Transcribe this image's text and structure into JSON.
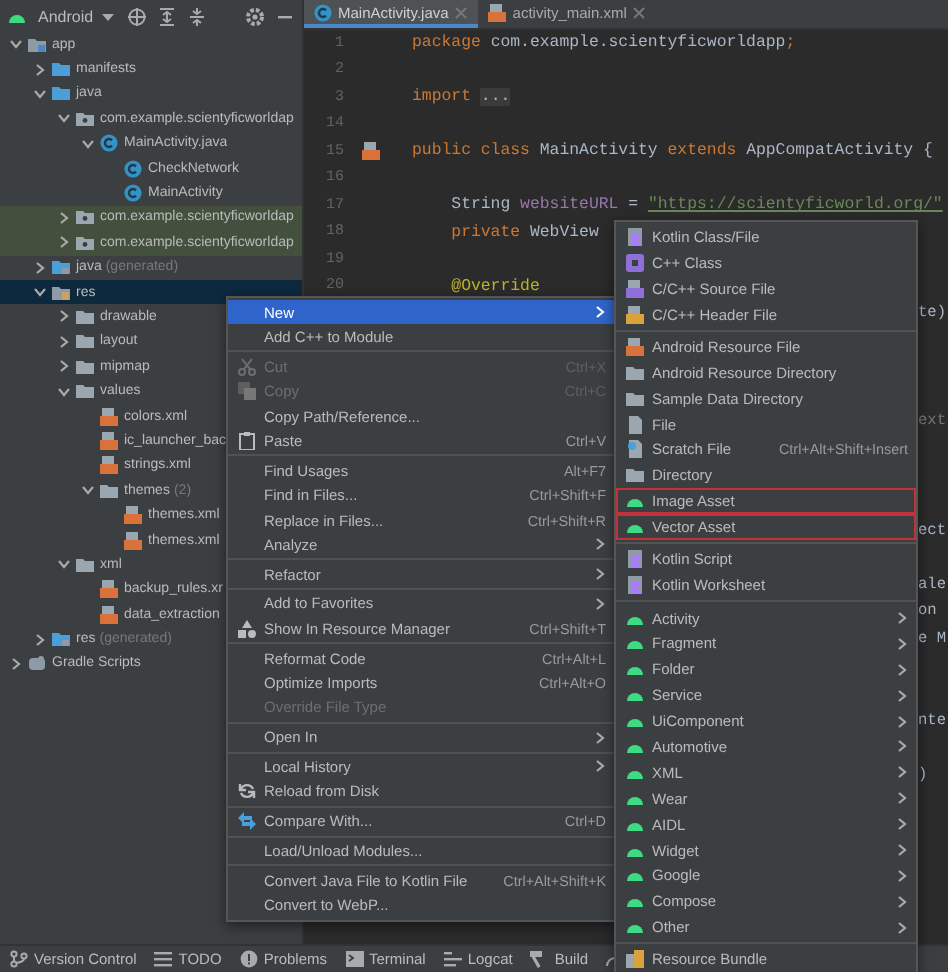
{
  "toolbar": {
    "title": "Android"
  },
  "tree": [
    {
      "label": "app",
      "kind": "module",
      "expanded": true,
      "selected": false,
      "highlighted": false,
      "children": [
        {
          "label": "manifests",
          "kind": "source-folder",
          "expanded": false,
          "selected": false,
          "highlighted": false
        },
        {
          "label": "java",
          "kind": "source-folder",
          "expanded": true,
          "selected": false,
          "highlighted": false,
          "children": [
            {
              "label": "com.example.scientyficworldap",
              "kind": "package",
              "expanded": true,
              "selected": false,
              "highlighted": false,
              "children": [
                {
                  "label": "MainActivity.java",
                  "kind": "class",
                  "expanded": true,
                  "selected": false,
                  "highlighted": false,
                  "children": [
                    {
                      "label": "CheckNetwork",
                      "kind": "class",
                      "selected": false,
                      "highlighted": false
                    },
                    {
                      "label": "MainActivity",
                      "kind": "class",
                      "selected": false,
                      "highlighted": false
                    }
                  ]
                }
              ]
            },
            {
              "label": "com.example.scientyficworldap",
              "kind": "package",
              "expanded": false,
              "selected": false,
              "highlighted": true
            },
            {
              "label": "com.example.scientyficworldap",
              "kind": "package",
              "expanded": false,
              "selected": false,
              "highlighted": true
            }
          ]
        },
        {
          "label": "java",
          "note": "(generated)",
          "kind": "generated-folder",
          "expanded": false,
          "selected": false,
          "highlighted": false
        },
        {
          "label": "res",
          "kind": "resource-folder",
          "expanded": true,
          "selected": true,
          "highlighted": false,
          "children": [
            {
              "label": "drawable",
              "kind": "folder",
              "expanded": false,
              "selected": false,
              "highlighted": false
            },
            {
              "label": "layout",
              "kind": "folder",
              "expanded": false,
              "selected": false,
              "highlighted": false
            },
            {
              "label": "mipmap",
              "kind": "folder",
              "expanded": false,
              "selected": false,
              "highlighted": false
            },
            {
              "label": "values",
              "kind": "folder",
              "expanded": true,
              "selected": false,
              "highlighted": false,
              "children": [
                {
                  "label": "colors.xml",
                  "kind": "xml-file",
                  "selected": false,
                  "highlighted": false
                },
                {
                  "label": "ic_launcher_bac",
                  "kind": "xml-file",
                  "selected": false,
                  "highlighted": false
                },
                {
                  "label": "strings.xml",
                  "kind": "xml-file",
                  "selected": false,
                  "highlighted": false
                },
                {
                  "label": "themes",
                  "note": "(2)",
                  "kind": "folder",
                  "expanded": true,
                  "selected": false,
                  "highlighted": false,
                  "children": [
                    {
                      "label": "themes.xml",
                      "kind": "xml-file",
                      "selected": false,
                      "highlighted": false
                    },
                    {
                      "label": "themes.xml",
                      "kind": "xml-file",
                      "selected": false,
                      "highlighted": false
                    }
                  ]
                }
              ]
            },
            {
              "label": "xml",
              "kind": "folder",
              "expanded": true,
              "selected": false,
              "highlighted": false,
              "children": [
                {
                  "label": "backup_rules.xr",
                  "kind": "xml-file",
                  "selected": false,
                  "highlighted": false
                },
                {
                  "label": "data_extraction",
                  "kind": "xml-file",
                  "selected": false,
                  "highlighted": false
                }
              ]
            }
          ]
        },
        {
          "label": "res",
          "note": "(generated)",
          "kind": "generated-folder",
          "expanded": false,
          "selected": false,
          "highlighted": false
        }
      ]
    },
    {
      "label": "Gradle Scripts",
      "kind": "gradle",
      "expanded": false,
      "selected": false,
      "highlighted": false
    }
  ],
  "tabs": [
    {
      "label": "MainActivity.java",
      "kind": "class",
      "selected": true
    },
    {
      "label": "activity_main.xml",
      "kind": "xml-file",
      "selected": false
    }
  ],
  "code": [
    {
      "number": "1",
      "marked": false,
      "segments": [
        {
          "text": "package ",
          "kind": "keyword"
        },
        {
          "text": "com.example.scientyficworldapp",
          "kind": "plain"
        },
        {
          "text": ";",
          "kind": "keyword"
        }
      ]
    },
    {
      "number": "2",
      "marked": false
    },
    {
      "number": "3",
      "marked": false,
      "segments": [
        {
          "text": "import ",
          "kind": "keyword"
        },
        {
          "text": "...",
          "kind": "folded"
        }
      ]
    },
    {
      "number": "14",
      "marked": false
    },
    {
      "number": "15",
      "marked": true,
      "segments": [
        {
          "text": "public class ",
          "kind": "keyword"
        },
        {
          "text": "MainActivity ",
          "kind": "plain"
        },
        {
          "text": "extends ",
          "kind": "keyword"
        },
        {
          "text": "AppCompatActivity {",
          "kind": "plain"
        }
      ]
    },
    {
      "number": "16",
      "marked": false
    },
    {
      "number": "17",
      "marked": false,
      "segments": [
        {
          "text": "    String ",
          "kind": "plain"
        },
        {
          "text": "websiteURL",
          "kind": "field"
        },
        {
          "text": " = ",
          "kind": "plain"
        },
        {
          "text": "\"https://scientyficworld.org/\"",
          "kind": "link"
        }
      ]
    },
    {
      "number": "18",
      "marked": false,
      "segments": [
        {
          "text": "    private ",
          "kind": "keyword"
        },
        {
          "text": "WebView",
          "kind": "plain"
        }
      ]
    },
    {
      "number": "19",
      "marked": false
    },
    {
      "number": "20",
      "marked": false,
      "segments": [
        {
          "text": "    @Override",
          "kind": "annotation"
        }
      ]
    }
  ],
  "code_tails": [
    {
      "tail": "te)",
      "kind": "code"
    },
    {
      "kind": "blank"
    },
    {
      "kind": "blank"
    },
    {
      "kind": "blank"
    },
    {
      "tail": "ext",
      "kind": "hint"
    },
    {
      "kind": "blank"
    },
    {
      "kind": "blank"
    },
    {
      "kind": "blank"
    },
    {
      "tail": "ect",
      "kind": "code"
    },
    {
      "kind": "blank"
    },
    {
      "tail": "ale",
      "kind": "code"
    },
    {
      "tail": "on",
      "kind": "code"
    },
    {
      "tail": "e M",
      "kind": "code"
    },
    {
      "kind": "blank"
    },
    {
      "kind": "blank"
    },
    {
      "tail": "nte",
      "kind": "code"
    },
    {
      "kind": "blank"
    },
    {
      "tail": ")",
      "kind": "code"
    }
  ],
  "context_menu": {
    "groups": [
      [
        {
          "label": "New",
          "selected": true,
          "disabled": false,
          "submenu": true
        },
        {
          "label": "Add C++ to Module",
          "selected": false,
          "disabled": false
        }
      ],
      [
        {
          "label": "Cut",
          "shortcut": "Ctrl+X",
          "kind": "cut",
          "selected": false,
          "disabled": true
        },
        {
          "label": "Copy",
          "shortcut": "Ctrl+C",
          "kind": "copy",
          "selected": false,
          "disabled": true
        },
        {
          "label": "Copy Path/Reference...",
          "selected": false,
          "disabled": false
        },
        {
          "label": "Paste",
          "shortcut": "Ctrl+V",
          "kind": "paste",
          "selected": false,
          "disabled": false
        }
      ],
      [
        {
          "label": "Find Usages",
          "shortcut": "Alt+F7",
          "selected": false,
          "disabled": false
        },
        {
          "label": "Find in Files...",
          "shortcut": "Ctrl+Shift+F",
          "selected": false,
          "disabled": false
        },
        {
          "label": "Replace in Files...",
          "shortcut": "Ctrl+Shift+R",
          "selected": false,
          "disabled": false
        },
        {
          "label": "Analyze",
          "selected": false,
          "disabled": false,
          "submenu": true
        }
      ],
      [
        {
          "label": "Refactor",
          "selected": false,
          "disabled": false,
          "submenu": true
        }
      ],
      [
        {
          "label": "Add to Favorites",
          "selected": false,
          "disabled": false,
          "submenu": true
        },
        {
          "label": "Show In Resource Manager",
          "shortcut": "Ctrl+Shift+T",
          "kind": "resources",
          "selected": false,
          "disabled": false
        }
      ],
      [
        {
          "label": "Reformat Code",
          "shortcut": "Ctrl+Alt+L",
          "selected": false,
          "disabled": false
        },
        {
          "label": "Optimize Imports",
          "shortcut": "Ctrl+Alt+O",
          "selected": false,
          "disabled": false
        },
        {
          "label": "Override File Type",
          "selected": false,
          "disabled": true
        }
      ],
      [
        {
          "label": "Open In",
          "selected": false,
          "disabled": false,
          "submenu": true
        }
      ],
      [
        {
          "label": "Local History",
          "selected": false,
          "disabled": false,
          "submenu": true
        },
        {
          "label": "Reload from Disk",
          "kind": "reload",
          "selected": false,
          "disabled": false
        }
      ],
      [
        {
          "label": "Compare With...",
          "shortcut": "Ctrl+D",
          "kind": "compare",
          "selected": false,
          "disabled": false
        }
      ],
      [
        {
          "label": "Load/Unload Modules...",
          "selected": false,
          "disabled": false
        }
      ],
      [
        {
          "label": "Convert Java File to Kotlin File",
          "shortcut": "Ctrl+Alt+Shift+K",
          "selected": false,
          "disabled": false
        },
        {
          "label": "Convert to WebP...",
          "selected": false,
          "disabled": false
        }
      ]
    ]
  },
  "new_submenu": {
    "groups": [
      [
        {
          "label": "Kotlin Class/File",
          "kind": "kotlin",
          "outlined": false
        },
        {
          "label": "C++ Class",
          "kind": "cpp",
          "outlined": false
        },
        {
          "label": "C/C++ Source File",
          "kind": "source",
          "outlined": false
        },
        {
          "label": "C/C++ Header File",
          "kind": "header",
          "outlined": false
        }
      ],
      [
        {
          "label": "Android Resource File",
          "kind": "resource",
          "outlined": false
        },
        {
          "label": "Android Resource Directory",
          "kind": "folder",
          "outlined": false
        },
        {
          "label": "Sample Data Directory",
          "kind": "folder",
          "outlined": false
        },
        {
          "label": "File",
          "kind": "file",
          "outlined": false
        },
        {
          "label": "Scratch File",
          "shortcut": "Ctrl+Alt+Shift+Insert",
          "kind": "scratch",
          "outlined": false
        },
        {
          "label": "Directory",
          "kind": "folder",
          "outlined": false
        },
        {
          "label": "Image Asset",
          "kind": "android",
          "outlined": true
        },
        {
          "label": "Vector Asset",
          "kind": "android",
          "outlined": true
        }
      ],
      [
        {
          "label": "Kotlin Script",
          "kind": "kotlin",
          "outlined": false
        },
        {
          "label": "Kotlin Worksheet",
          "kind": "kotlin",
          "outlined": false
        }
      ],
      [
        {
          "label": "Activity",
          "kind": "android",
          "outlined": false,
          "submenu": true
        },
        {
          "label": "Fragment",
          "kind": "android",
          "outlined": false,
          "submenu": true
        },
        {
          "label": "Folder",
          "kind": "android",
          "outlined": false,
          "submenu": true
        },
        {
          "label": "Service",
          "kind": "android",
          "outlined": false,
          "submenu": true
        },
        {
          "label": "UiComponent",
          "kind": "android",
          "outlined": false,
          "submenu": true
        },
        {
          "label": "Automotive",
          "kind": "android",
          "outlined": false,
          "submenu": true
        },
        {
          "label": "XML",
          "kind": "android",
          "outlined": false,
          "submenu": true
        },
        {
          "label": "Wear",
          "kind": "android",
          "outlined": false,
          "submenu": true
        },
        {
          "label": "AIDL",
          "kind": "android",
          "outlined": false,
          "submenu": true
        },
        {
          "label": "Widget",
          "kind": "android",
          "outlined": false,
          "submenu": true
        },
        {
          "label": "Google",
          "kind": "android",
          "outlined": false,
          "submenu": true
        },
        {
          "label": "Compose",
          "kind": "android",
          "outlined": false,
          "submenu": true
        },
        {
          "label": "Other",
          "kind": "android",
          "outlined": false,
          "submenu": true
        }
      ],
      [
        {
          "label": "Resource Bundle",
          "kind": "bundle",
          "outlined": false
        }
      ]
    ]
  },
  "status_bar": [
    {
      "label": "Version Control",
      "kind": "vcs"
    },
    {
      "label": "TODO",
      "kind": "list"
    },
    {
      "label": "Problems",
      "kind": "problems"
    },
    {
      "label": "Terminal",
      "kind": "terminal"
    },
    {
      "label": "Logcat",
      "kind": "logcat"
    },
    {
      "label": "Build",
      "kind": "build"
    }
  ]
}
